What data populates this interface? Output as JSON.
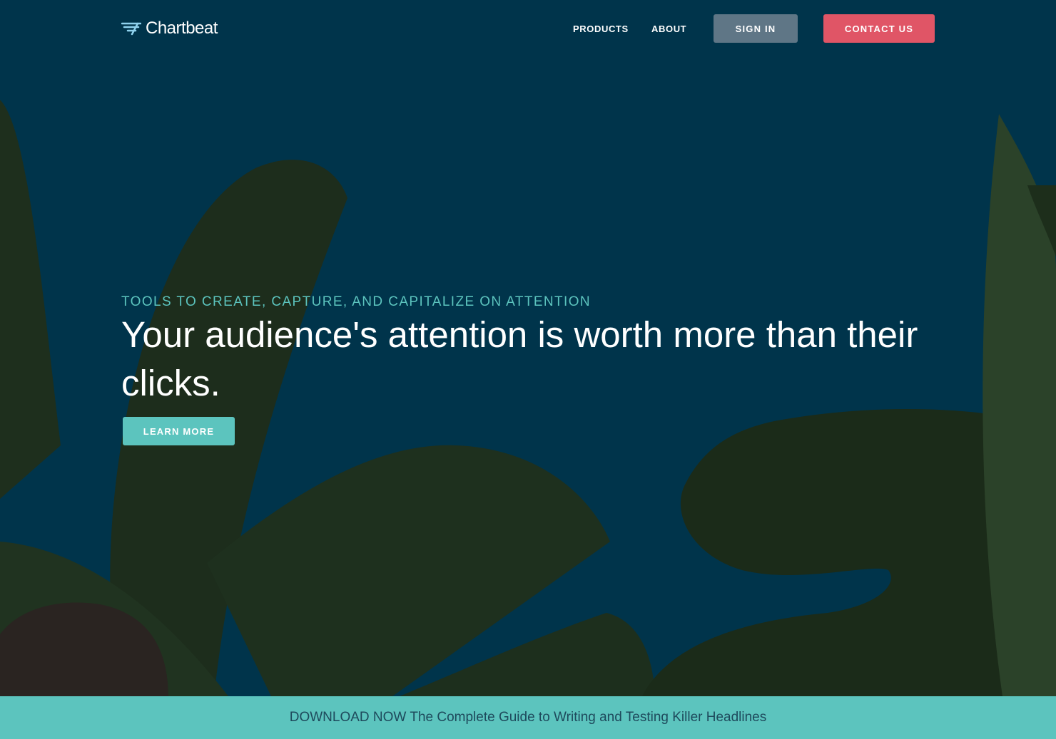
{
  "brand": {
    "name": "Chartbeat",
    "logo_icon": "chartbeat-logo-icon"
  },
  "nav": {
    "products_label": "PRODUCTS",
    "about_label": "ABOUT",
    "sign_in_label": "SIGN IN",
    "contact_label": "CONTACT US"
  },
  "hero": {
    "eyebrow": "TOOLS TO CREATE, CAPTURE, AND CAPITALIZE ON ATTENTION",
    "headline": "Your audience's attention is worth more than their clicks.",
    "cta_label": "LEARN MORE"
  },
  "banner": {
    "prefix": "DOWNLOAD NOW",
    "text": "The Complete Guide to Writing and Testing Killer Headlines"
  },
  "colors": {
    "background": "#00344b",
    "accent_teal": "#5cc4be",
    "contact_red": "#e05566",
    "signin_gray": "#5f7686",
    "leaf_green_dark": "#1b2b1c",
    "leaf_green": "#263f28",
    "leaf_brown": "#2a2421"
  }
}
